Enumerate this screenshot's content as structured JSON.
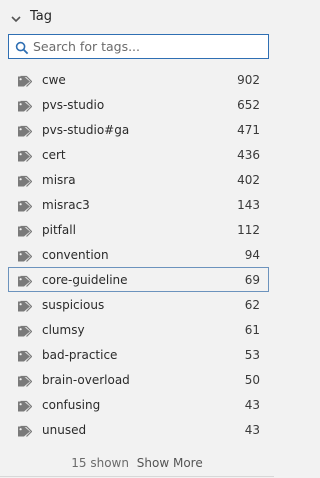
{
  "section": {
    "title": "Tag",
    "collapse_icon": "chevron-down-icon"
  },
  "search": {
    "placeholder": "Search for tags...",
    "value": "",
    "icon": "search-icon",
    "accent_color": "#2f6fb3"
  },
  "tags": [
    {
      "label": "cwe",
      "count": "902"
    },
    {
      "label": "pvs-studio",
      "count": "652"
    },
    {
      "label": "pvs-studio#ga",
      "count": "471"
    },
    {
      "label": "cert",
      "count": "436"
    },
    {
      "label": "misra",
      "count": "402"
    },
    {
      "label": "misrac3",
      "count": "143"
    },
    {
      "label": "pitfall",
      "count": "112"
    },
    {
      "label": "convention",
      "count": "94"
    },
    {
      "label": "core-guideline",
      "count": "69",
      "selected": true
    },
    {
      "label": "suspicious",
      "count": "62"
    },
    {
      "label": "clumsy",
      "count": "61"
    },
    {
      "label": "bad-practice",
      "count": "53"
    },
    {
      "label": "brain-overload",
      "count": "50"
    },
    {
      "label": "confusing",
      "count": "43"
    },
    {
      "label": "unused",
      "count": "43"
    }
  ],
  "tag_icon": "tag-icon",
  "footer": {
    "shown_text": "15 shown",
    "show_more_label": "Show More"
  }
}
